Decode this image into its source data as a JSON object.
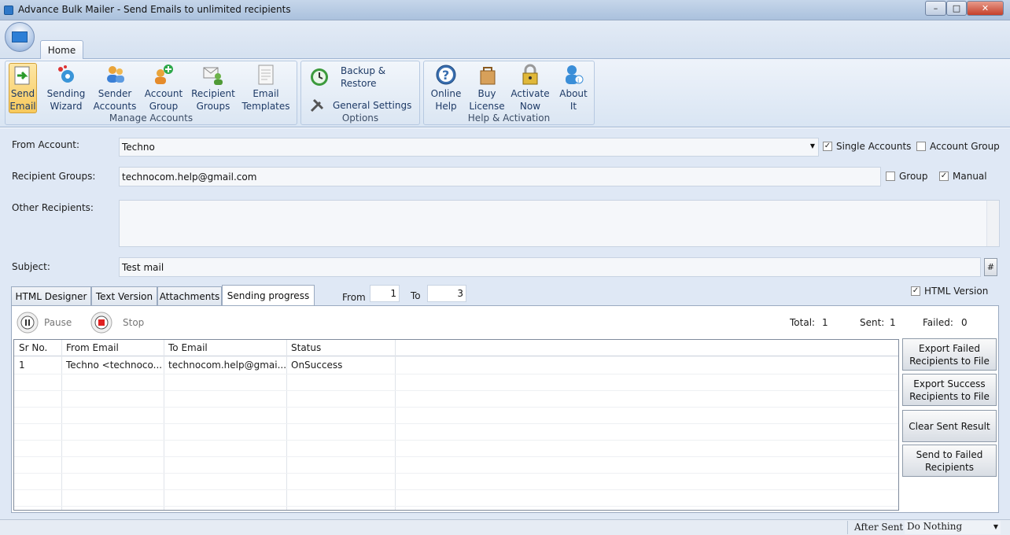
{
  "window": {
    "title": "Advance Bulk Mailer - Send Emails to unlimited recipients"
  },
  "tabs": {
    "home": "Home"
  },
  "ribbon": {
    "manage": {
      "label": "Manage Accounts",
      "buttons": [
        {
          "l1": "Send",
          "l2": "Email",
          "icon": "send-email-icon"
        },
        {
          "l1": "Sending",
          "l2": "Wizard",
          "icon": "wizard-gear-icon"
        },
        {
          "l1": "Sender",
          "l2": "Accounts",
          "icon": "users-icon"
        },
        {
          "l1": "Account",
          "l2": "Group",
          "icon": "add-user-icon"
        },
        {
          "l1": "Recipient",
          "l2": "Groups",
          "icon": "recipient-group-icon"
        },
        {
          "l1": "Email",
          "l2": "Templates",
          "icon": "template-icon"
        }
      ]
    },
    "options": {
      "label": "Options",
      "backup_l1": "Backup &",
      "backup_l2": "Restore",
      "general": "General Settings"
    },
    "help": {
      "label": "Help & Activation",
      "buttons": [
        {
          "l1": "Online",
          "l2": "Help",
          "icon": "help-icon"
        },
        {
          "l1": "Buy",
          "l2": "License",
          "icon": "shopping-bag-icon"
        },
        {
          "l1": "Activate",
          "l2": "Now",
          "icon": "lock-icon"
        },
        {
          "l1": "About",
          "l2": "It",
          "icon": "info-user-icon"
        }
      ]
    }
  },
  "form": {
    "from_label": "From Account:",
    "from_value": "Techno",
    "single_accounts": "Single Accounts",
    "account_group": "Account Group",
    "recipient_label": "Recipient Groups:",
    "recipient_value": "technocom.help@gmail.com",
    "group": "Group",
    "manual": "Manual",
    "other_label": "Other Recipients:",
    "other_value": "",
    "subject_label": "Subject:",
    "subject_value": "Test mail",
    "hash_btn": "#"
  },
  "editor_tabs": [
    "HTML Designer",
    "Text Version",
    "Attachments",
    "Sending progress"
  ],
  "range": {
    "from_label": "From",
    "from_value": "1",
    "to_label": "To",
    "to_value": "3"
  },
  "html_version": "HTML Version",
  "progress": {
    "pause": "Pause",
    "stop": "Stop",
    "total_label": "Total:",
    "total": "1",
    "sent_label": "Sent:",
    "sent": "1",
    "failed_label": "Failed:",
    "failed": "0"
  },
  "table": {
    "headers": [
      "Sr No.",
      "From Email",
      "To Email",
      "Status"
    ],
    "rows": [
      [
        "1",
        "Techno <technoco...",
        "technocom.help@gmai...",
        "OnSuccess"
      ]
    ]
  },
  "side_buttons": {
    "export_failed_1": "Export Failed",
    "export_failed_2": "Recipients to File",
    "export_success_1": "Export Success",
    "export_success_2": "Recipients to File",
    "clear": "Clear Sent Result",
    "send_failed_1": "Send to Failed",
    "send_failed_2": "Recipients"
  },
  "status": {
    "after_sent_label": "After Sent",
    "after_sent_value": "Do Nothing"
  },
  "colors": {
    "accent": "#2e78c8",
    "ribbon": "#dfe8f5",
    "active": "#f8c95c"
  }
}
